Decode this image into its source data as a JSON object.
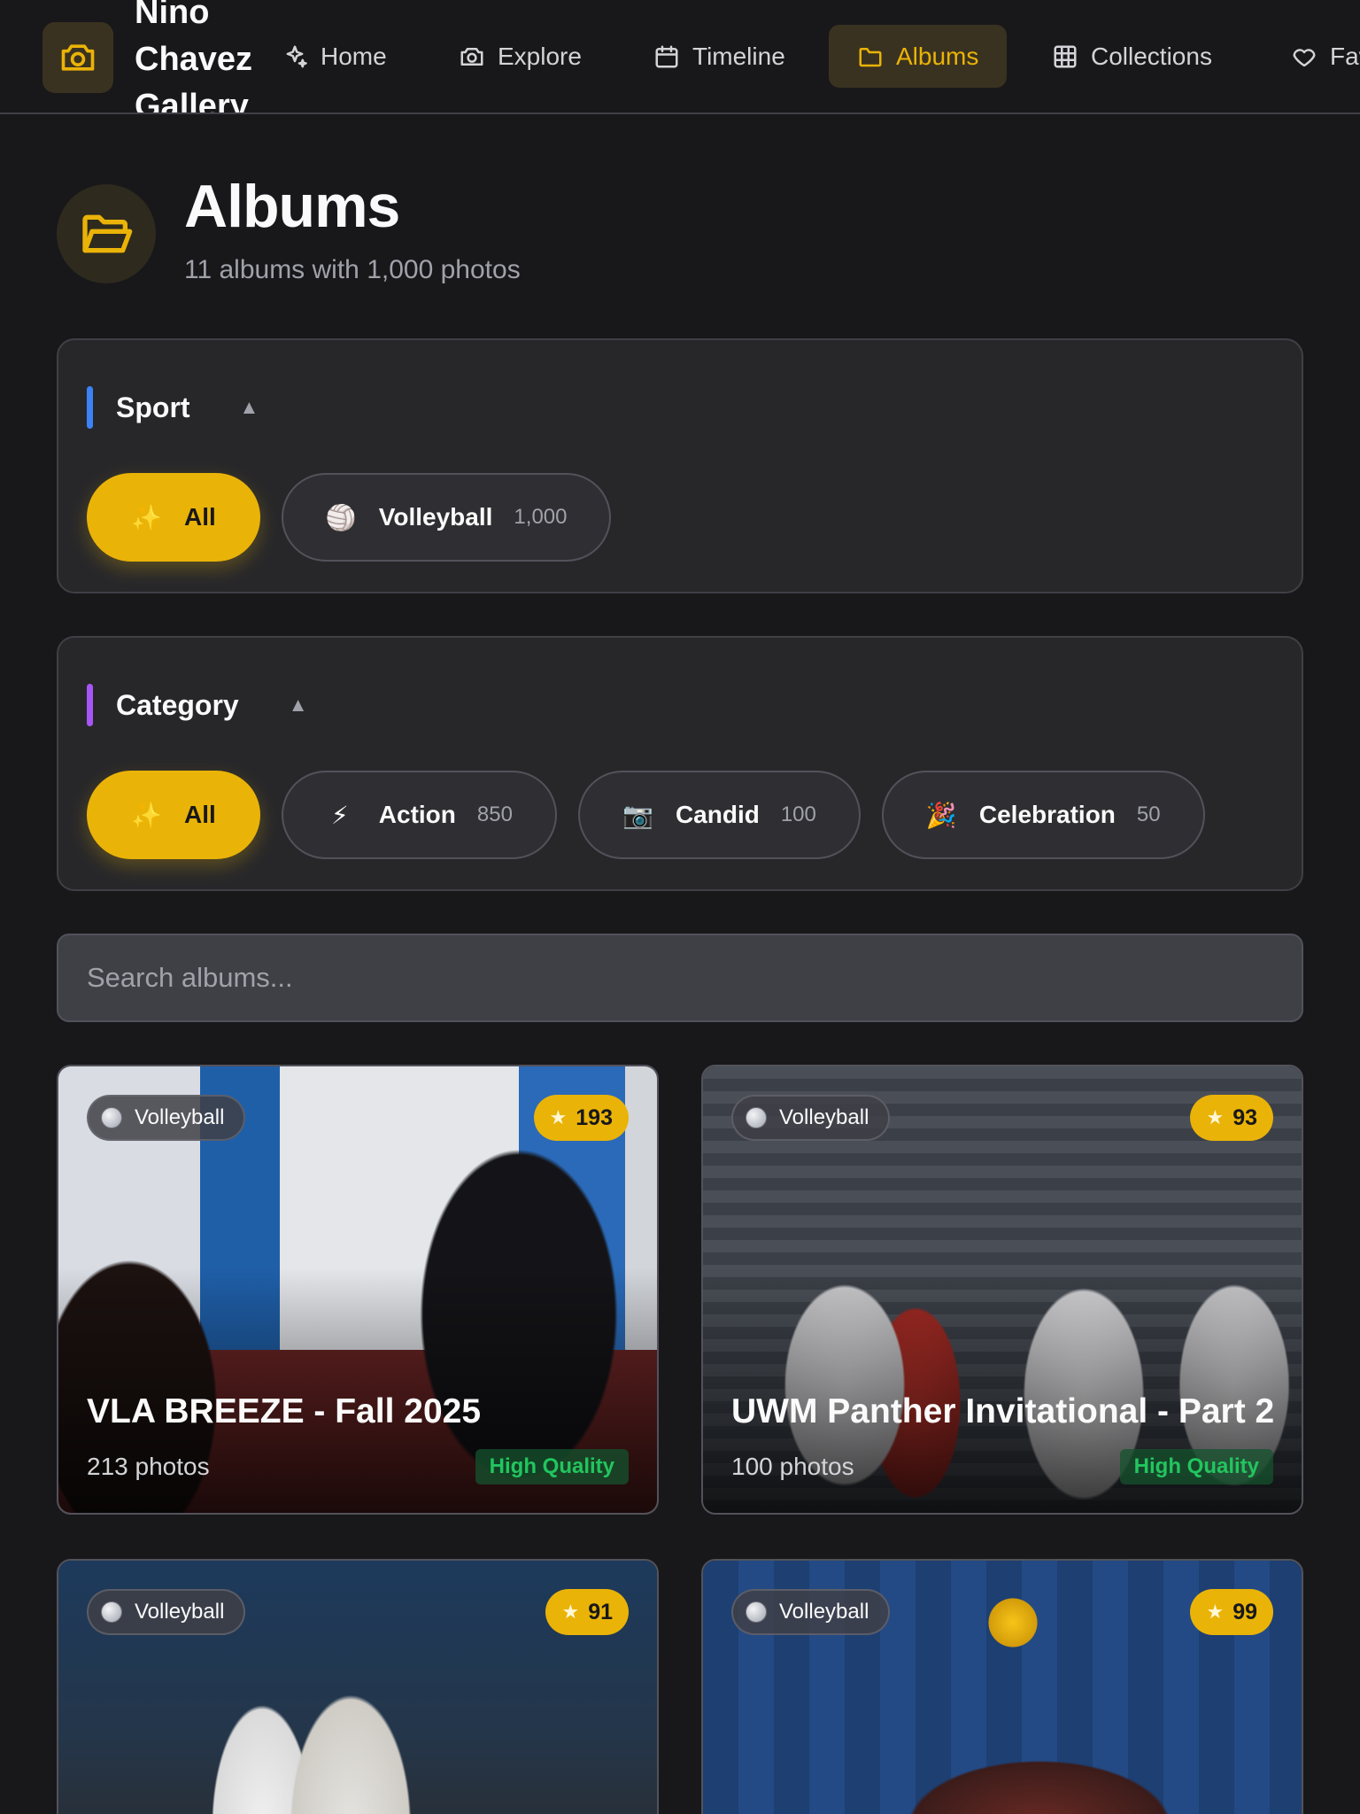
{
  "nav": {
    "brand": "Nino Chavez Gallery",
    "items": [
      {
        "label": "Home",
        "icon": "sparkles-icon"
      },
      {
        "label": "Explore",
        "icon": "camera-icon"
      },
      {
        "label": "Timeline",
        "icon": "calendar-icon"
      },
      {
        "label": "Albums",
        "icon": "folder-icon",
        "active": true
      },
      {
        "label": "Collections",
        "icon": "grid-icon"
      },
      {
        "label": "Favorites",
        "icon": "heart-icon"
      }
    ]
  },
  "header": {
    "title": "Albums",
    "subtitle": "11 albums with 1,000 photos",
    "icon": "folder-open-icon"
  },
  "filters": {
    "sport": {
      "label": "Sport",
      "accent": "#3b82f6",
      "chips": [
        {
          "emoji": "✨",
          "label": "All",
          "count": "",
          "active": true
        },
        {
          "emoji": "🏐",
          "label": "Volleyball",
          "count": "1,000"
        }
      ]
    },
    "category": {
      "label": "Category",
      "accent": "#a855f7",
      "chips": [
        {
          "emoji": "✨",
          "label": "All",
          "count": "",
          "active": true
        },
        {
          "emoji": "⚡",
          "label": "Action",
          "count": "850"
        },
        {
          "emoji": "📷",
          "label": "Candid",
          "count": "100"
        },
        {
          "emoji": "🎉",
          "label": "Celebration",
          "count": "50"
        }
      ]
    }
  },
  "search": {
    "placeholder": "Search albums..."
  },
  "albums": [
    {
      "sport": "Volleyball",
      "score": "193",
      "title": "VLA BREEZE - Fall 2025",
      "count": "213 photos",
      "badge": "High Quality"
    },
    {
      "sport": "Volleyball",
      "score": "93",
      "title": "UWM Panther Invitational - Part 2",
      "count": "100 photos",
      "badge": "High Quality"
    },
    {
      "sport": "Volleyball",
      "score": "91",
      "title": "",
      "count": "",
      "badge": ""
    },
    {
      "sport": "Volleyball",
      "score": "99",
      "title": "",
      "count": "",
      "badge": ""
    }
  ],
  "colors": {
    "accent": "#eab308",
    "background": "#18181b",
    "panel": "#27272a",
    "quality": "#22c55e"
  }
}
